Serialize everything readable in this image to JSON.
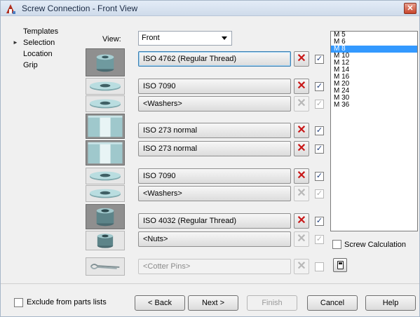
{
  "window": {
    "title": "Screw Connection - Front View",
    "close_glyph": "✕"
  },
  "nav": {
    "items": [
      {
        "label": "Templates",
        "active": false
      },
      {
        "label": "Selection",
        "active": true,
        "marker": "►"
      },
      {
        "label": "Location",
        "active": false
      },
      {
        "label": "Grip",
        "active": false
      }
    ]
  },
  "view": {
    "label": "View:",
    "value": "Front"
  },
  "rows": [
    {
      "part": "ISO 4762  (Regular Thread)",
      "icon": "cap-screw-icon",
      "remove": "✕",
      "check": "✓",
      "enabled": true
    },
    {
      "part": "ISO 7090",
      "icon": "washer-icon",
      "remove": "✕",
      "check": "✓",
      "enabled": true
    },
    {
      "part": "<Washers>",
      "icon": "washer-icon",
      "remove": "✕",
      "check": "✓",
      "enabled": false
    },
    {
      "part": "ISO 273 normal",
      "icon": "through-hole-icon",
      "remove": "✕",
      "check": "✓",
      "enabled": true
    },
    {
      "part": "ISO 273 normal",
      "icon": "through-hole-icon",
      "remove": "✕",
      "check": "✓",
      "enabled": true
    },
    {
      "part": "ISO 7090",
      "icon": "washer-icon",
      "remove": "✕",
      "check": "✓",
      "enabled": true
    },
    {
      "part": "<Washers>",
      "icon": "washer-icon",
      "remove": "✕",
      "check": "✓",
      "enabled": false
    },
    {
      "part": "ISO 4032  (Regular Thread)",
      "icon": "hex-nut-icon",
      "remove": "✕",
      "check": "✓",
      "enabled": true
    },
    {
      "part": "<Nuts>",
      "icon": "hex-nut-icon",
      "remove": "✕",
      "check": "✓",
      "enabled": false
    },
    {
      "part": "<Cotter Pins>",
      "icon": "cotter-pin-icon",
      "remove": "✕",
      "check": "",
      "enabled": false
    }
  ],
  "sizes": {
    "items": [
      "M 5",
      "M 6",
      "M 8",
      "M 10",
      "M 12",
      "M 14",
      "M 16",
      "M 20",
      "M 24",
      "M 30",
      "M 36"
    ],
    "selected": "M 8"
  },
  "screw_calc": {
    "label": "Screw Calculation",
    "icon": "calculator-icon"
  },
  "footer": {
    "exclude_label": "Exclude from parts lists",
    "back": "< Back",
    "next": "Next >",
    "finish": "Finish",
    "cancel": "Cancel",
    "help": "Help"
  },
  "colors": {
    "remove_x": "#c81818",
    "selection": "#3399ff",
    "accent_border": "#3c7fb1"
  }
}
